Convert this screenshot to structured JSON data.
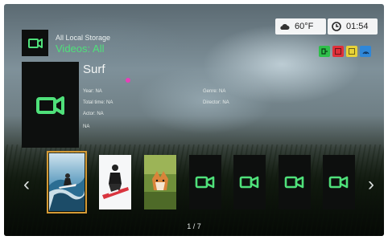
{
  "header": {
    "source": "All Local Storage",
    "view": "Videos: All"
  },
  "status": {
    "temperature": "60°F",
    "weather_icon": "cloud-icon",
    "time": "01:54",
    "clock_icon": "clock-icon"
  },
  "color_buttons": [
    {
      "name": "green",
      "color": "#2fbf4a"
    },
    {
      "name": "red",
      "color": "#e0303a"
    },
    {
      "name": "yellow",
      "color": "#e7d238"
    },
    {
      "name": "blue",
      "color": "#2f87d8"
    }
  ],
  "selected": {
    "title": "Surf",
    "year": "Year: NA",
    "total_time": "Total time: NA",
    "actor": "Actor: NA",
    "na": "NA",
    "genre": "Genre: NA",
    "director": "Director: NA"
  },
  "pager": "1 / 7",
  "colors": {
    "accent_green": "#4fe07a",
    "selection_border": "#d49a35",
    "marker_pink": "#e83fb8"
  }
}
